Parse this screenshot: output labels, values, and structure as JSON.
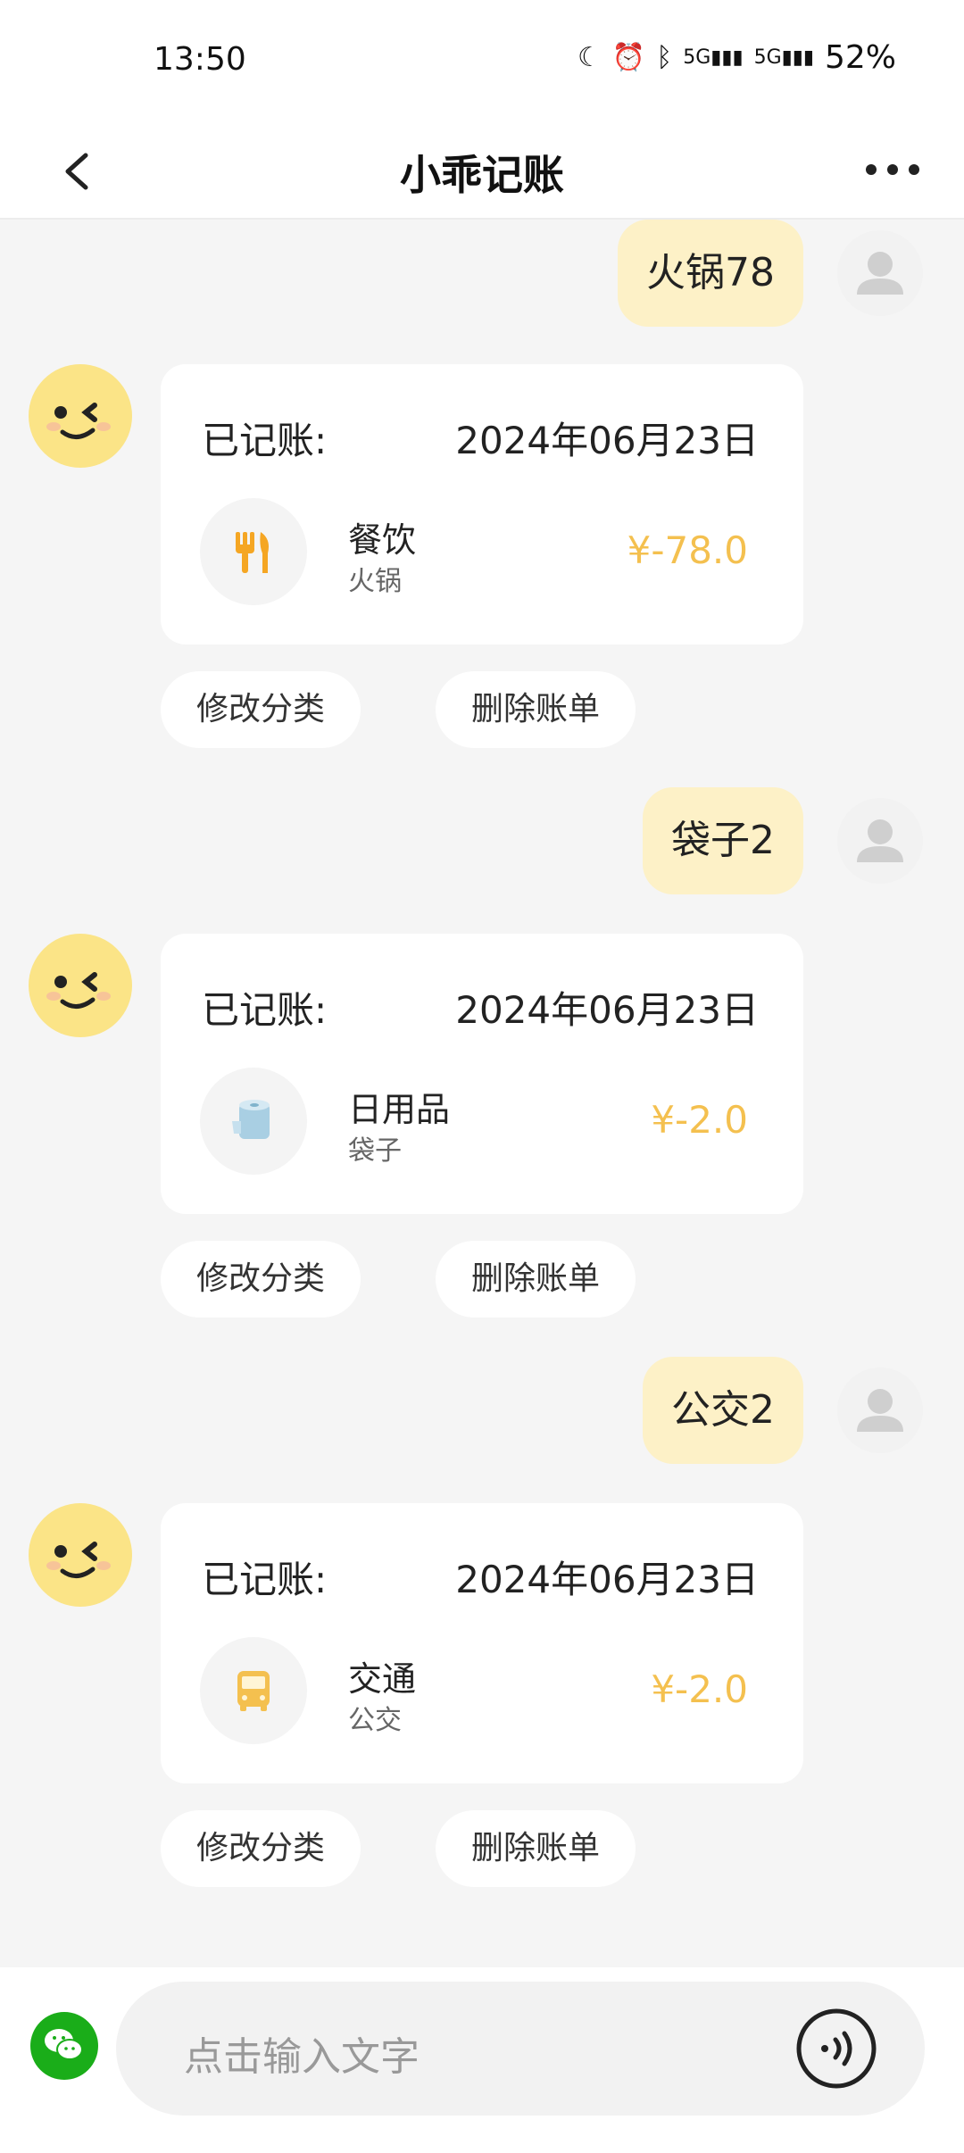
{
  "status": {
    "time": "13:50",
    "signal1": "5G",
    "signal2": "5G",
    "battery": "52%"
  },
  "nav": {
    "title": "小乖记账"
  },
  "messages": [
    {
      "user_text": "火锅78",
      "card_title": "已记账:",
      "date": "2024年06月23日",
      "category": "餐饮",
      "note": "火锅",
      "amount": "¥-78.0",
      "icon": "fork-knife-icon",
      "icon_color": "#f5a623"
    },
    {
      "user_text": "袋子2",
      "card_title": "已记账:",
      "date": "2024年06月23日",
      "category": "日用品",
      "note": "袋子",
      "amount": "¥-2.0",
      "icon": "tissue-roll-icon",
      "icon_color": "#a9cfe3"
    },
    {
      "user_text": "公交2",
      "card_title": "已记账:",
      "date": "2024年06月23日",
      "category": "交通",
      "note": "公交",
      "amount": "¥-2.0",
      "icon": "bus-icon",
      "icon_color": "#f4c04f"
    }
  ],
  "actions": {
    "edit_category": "修改分类",
    "delete_bill": "删除账单"
  },
  "input": {
    "placeholder": "点击输入文字"
  },
  "colors": {
    "user_bubble": "#fdf1c7",
    "amount": "#f4c04f",
    "wechat": "#1aad19"
  }
}
